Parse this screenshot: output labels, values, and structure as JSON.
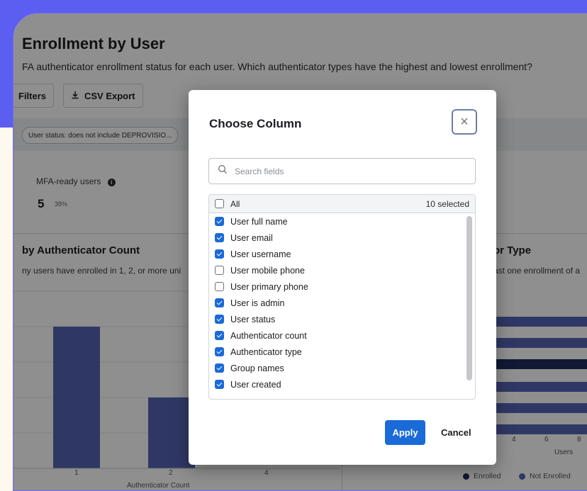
{
  "page": {
    "title": "Enrollment by User",
    "subtitle": "FA authenticator enrollment status for each user. Which authenticator types have the highest and lowest enrollment?",
    "filters_label": "Filters",
    "csv_export_label": "CSV Export",
    "filter_chip": "User status: does not include DEPROVISIO...",
    "metric": {
      "label": "MFA-ready users",
      "value": "5",
      "percent": "38%"
    },
    "left_section": {
      "title": "by Authenticator Count",
      "subtitle": "ny users have enrolled in 1, 2, or more uni"
    },
    "right_section": {
      "title": "or Type",
      "subtitle": "ast one enrollment of a"
    },
    "left_chart": {
      "x_ticks": [
        "1",
        "2",
        "4"
      ],
      "x_label": "Authenticator Count"
    },
    "right_chart": {
      "x_ticks": [
        "4",
        "6",
        "8"
      ],
      "x_label": "Users",
      "legend": [
        "Enrolled",
        "Not Enrolled"
      ]
    }
  },
  "chart_data": [
    {
      "type": "bar",
      "categories": [
        "1",
        "2",
        "4"
      ],
      "values": [
        8,
        4,
        0
      ],
      "xlabel": "Authenticator Count",
      "color": "#5565b5"
    },
    {
      "type": "bar",
      "orientation": "horizontal",
      "series": [
        {
          "name": "Enrolled",
          "color": "#1f2e5e"
        },
        {
          "name": "Not Enrolled",
          "color": "#5565b5"
        }
      ],
      "xlabel": "Users",
      "x_ticks": [
        "4",
        "6",
        "8"
      ]
    }
  ],
  "modal": {
    "title": "Choose Column",
    "close_icon": "close-icon",
    "search_placeholder": "Search fields",
    "all_label": "All",
    "selected_count": "10 selected",
    "fields": [
      {
        "label": "User full name",
        "checked": true
      },
      {
        "label": "User email",
        "checked": true
      },
      {
        "label": "User username",
        "checked": true
      },
      {
        "label": "User mobile phone",
        "checked": false
      },
      {
        "label": "User primary phone",
        "checked": false
      },
      {
        "label": "User is admin",
        "checked": true
      },
      {
        "label": "User status",
        "checked": true
      },
      {
        "label": "Authenticator count",
        "checked": true
      },
      {
        "label": "Authenticator type",
        "checked": true
      },
      {
        "label": "Group names",
        "checked": true
      },
      {
        "label": "User created",
        "checked": true
      }
    ],
    "apply_label": "Apply",
    "cancel_label": "Cancel"
  },
  "colors": {
    "accent": "#1a6ad8",
    "bar": "#5565b5",
    "bar_dark": "#1f2e5e",
    "frame": "#5b5ef0"
  }
}
